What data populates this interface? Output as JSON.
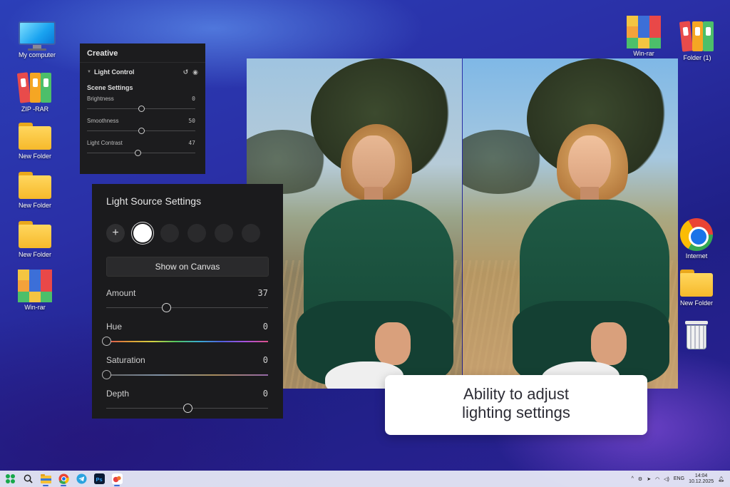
{
  "desktop_left": [
    {
      "label": "My computer",
      "icon": "monitor-icon"
    },
    {
      "label": "ZIP -RAR",
      "icon": "archive-binders-icon"
    },
    {
      "label": "New Folder",
      "icon": "folder-icon"
    },
    {
      "label": "New Folder",
      "icon": "folder-icon"
    },
    {
      "label": "New Folder",
      "icon": "folder-icon"
    },
    {
      "label": "Win-rar",
      "icon": "winrar-icon"
    }
  ],
  "desktop_right": [
    {
      "label": "Win-rar",
      "icon": "winrar-icon"
    },
    {
      "label": "Folder (1)",
      "icon": "archive-binders-icon"
    },
    {
      "label": "Internet",
      "icon": "chrome-icon"
    },
    {
      "label": "New Folder",
      "icon": "folder-icon"
    },
    {
      "label": "",
      "icon": "recycle-bin-icon"
    }
  ],
  "creative_panel": {
    "title": "Creative",
    "section": "Light Control",
    "subsection": "Scene Settings",
    "sliders": [
      {
        "label": "Brightness",
        "value": "0",
        "fraction": 0.5
      },
      {
        "label": "Smoothness",
        "value": "50",
        "fraction": 0.5
      },
      {
        "label": "Light Contrast",
        "value": "47",
        "fraction": 0.47
      }
    ]
  },
  "light_source_panel": {
    "title": "Light Source Settings",
    "add_symbol": "+",
    "show_on_canvas": "Show on Canvas",
    "sliders": [
      {
        "label": "Amount",
        "value": "37",
        "fraction": 0.37
      },
      {
        "label": "Hue",
        "value": "0",
        "fraction": 0.0
      },
      {
        "label": "Saturation",
        "value": "0",
        "fraction": 0.0
      },
      {
        "label": "Depth",
        "value": "0",
        "fraction": 0.5
      }
    ]
  },
  "caption": {
    "line1": "Ability to adjust",
    "line2": "lighting settings"
  },
  "taskbar": {
    "lang": "ENG",
    "time": "14:04",
    "date": "10.12.2025"
  },
  "colors": {
    "panel_bg": "#1c1c1e",
    "sweater": "#1f5a45",
    "accent_blue": "#2a2fa6"
  }
}
